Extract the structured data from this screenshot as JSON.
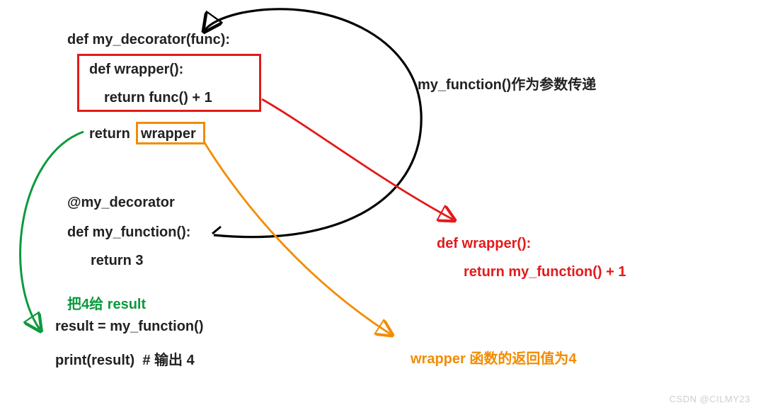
{
  "code": {
    "l1": "def my_decorator(func):",
    "l2": "def wrapper():",
    "l3": "return func() + 1",
    "l4_a": "return ",
    "l4_b": "wrapper",
    "l5": "@my_decorator",
    "l6": "def my_function():",
    "l7": "return 3",
    "l8_label": "把4给 result",
    "l9": "result = my_function()",
    "l10": "print(result)  # 输出 4"
  },
  "annotations": {
    "top_right": "my_function()作为参数传递",
    "mid_right_l1": "def wrapper():",
    "mid_right_l2": "return my_function() + 1",
    "bottom_right": "wrapper 函数的返回值为4"
  },
  "watermark": "CSDN @CILMY23",
  "colors": {
    "red": "#e31a1a",
    "orange": "#f28c00",
    "green": "#0b9a3c",
    "black": "#000000"
  }
}
